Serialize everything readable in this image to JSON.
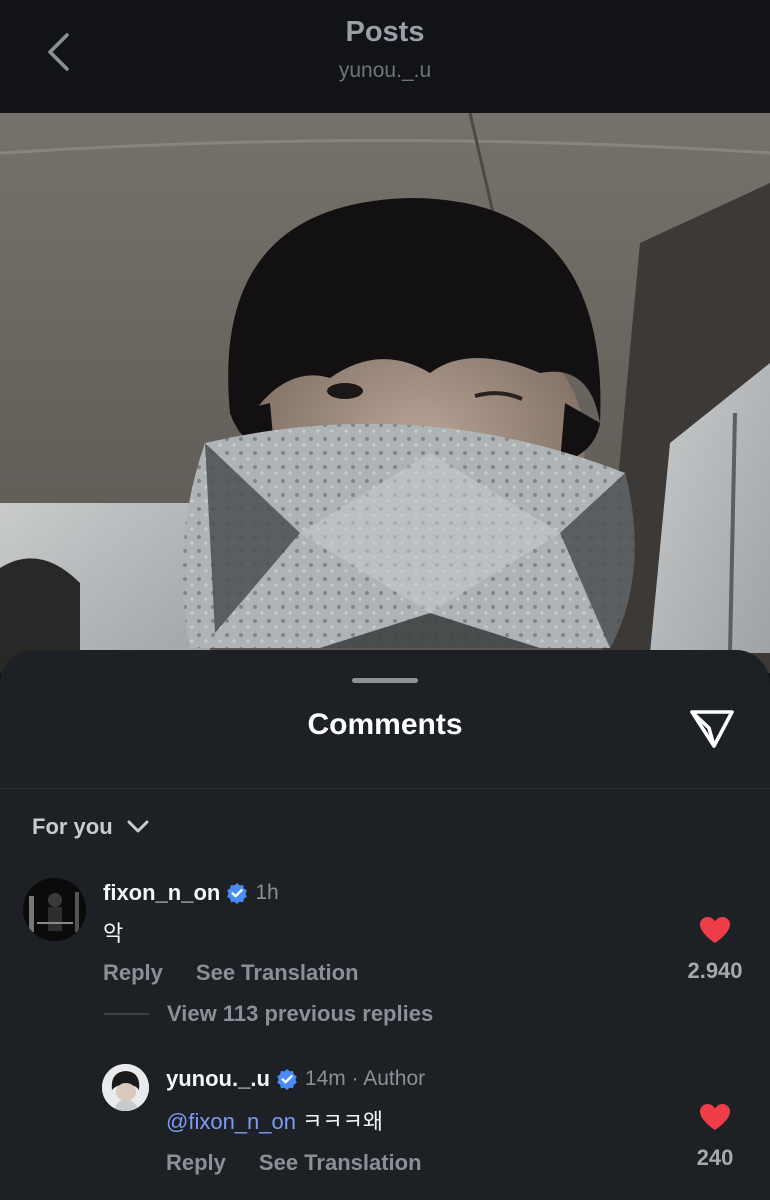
{
  "header": {
    "title": "Posts",
    "subtitle": "yunou._.u"
  },
  "sheet": {
    "title": "Comments",
    "sort_label": "For you"
  },
  "comments": [
    {
      "username": "fixon_n_on",
      "verified": true,
      "time": "1h",
      "text": "악",
      "reply_label": "Reply",
      "translate_label": "See Translation",
      "likes": "2.940"
    }
  ],
  "view_replies": "View 113 previous replies",
  "replies": [
    {
      "username": "yunou._.u",
      "verified": true,
      "time": "14m · Author",
      "mention": "@fixon_n_on",
      "text": "ㅋㅋㅋ왜",
      "reply_label": "Reply",
      "translate_label": "See Translation",
      "likes": "240"
    }
  ],
  "colors": {
    "background": "#1d2024",
    "like_red": "#ee3d48",
    "verified_blue": "#4a8cf7",
    "mention_blue": "#7d9bf7"
  },
  "icons": [
    "back-chevron-icon",
    "send-icon",
    "chevron-down-icon",
    "verified-badge-icon",
    "heart-icon"
  ]
}
